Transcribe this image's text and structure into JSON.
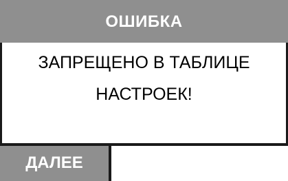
{
  "dialog": {
    "title": "ОШИБКА",
    "message_line1": "ЗАПРЕЩЕНО В ТАБЛИЦЕ",
    "message_line2": "НАСТРОЕК!",
    "next_label": "ДАЛЕЕ"
  },
  "colors": {
    "title_bg": "#8f8f8f",
    "button_bg": "#8f8f8f",
    "border": "#1a1a1a",
    "text_light": "#ffffff",
    "text_dark": "#000000",
    "background": "#ffffff"
  }
}
